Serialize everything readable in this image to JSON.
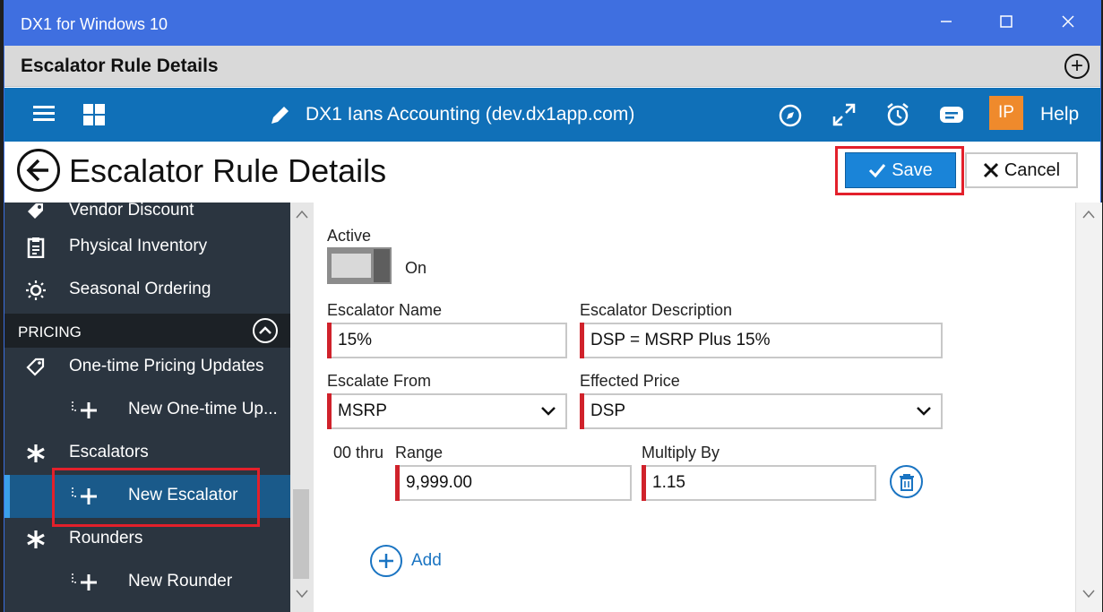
{
  "window": {
    "title": "DX1 for Windows 10",
    "minimize_icon": "minimize-icon",
    "maximize_icon": "maximize-icon",
    "close_icon": "close-icon"
  },
  "app_header": {
    "title": "Escalator Rule Details"
  },
  "toolbar": {
    "company": "DX1 Ians Accounting (dev.dx1app.com)",
    "user_initials": "IP",
    "help": "Help",
    "accent": "#1070b8",
    "user_badge_color": "#ef8a2c"
  },
  "page": {
    "title": "Escalator Rule Details",
    "save_label": "Save",
    "cancel_label": "Cancel",
    "save_color": "#1a84d8",
    "highlight_color": "#e3202b"
  },
  "sidebar": {
    "items": [
      {
        "label": "Vendor Discount",
        "icon": "vendor-discount-icon"
      },
      {
        "label": "Physical Inventory",
        "icon": "clipboard-icon"
      },
      {
        "label": "Seasonal Ordering",
        "icon": "sun-icon"
      }
    ],
    "section": "PRICING",
    "pricing_items": [
      {
        "label": "One-time Pricing Updates",
        "icon": "price-tag-icon"
      },
      {
        "label": "New One-time Up...",
        "icon": "plus-icon"
      },
      {
        "label": "Escalators",
        "icon": "asterisk-icon"
      },
      {
        "label": "New Escalator",
        "icon": "plus-icon",
        "active": true
      },
      {
        "label": "Rounders",
        "icon": "asterisk-icon"
      },
      {
        "label": "New Rounder",
        "icon": "plus-icon"
      }
    ]
  },
  "form": {
    "active_label": "Active",
    "active_state": "On",
    "name_label": "Escalator Name",
    "name_value": "15%",
    "description_label": "Escalator Description",
    "description_value": "DSP = MSRP Plus 15%",
    "escalate_from_label": "Escalate From",
    "escalate_from_value": "MSRP",
    "effected_price_label": "Effected Price",
    "effected_price_value": "DSP",
    "range_prefix": "00 thru",
    "range_label": "Range",
    "range_value": "9,999.00",
    "multiply_label": "Multiply By",
    "multiply_value": "1.15",
    "add_label": "Add"
  }
}
